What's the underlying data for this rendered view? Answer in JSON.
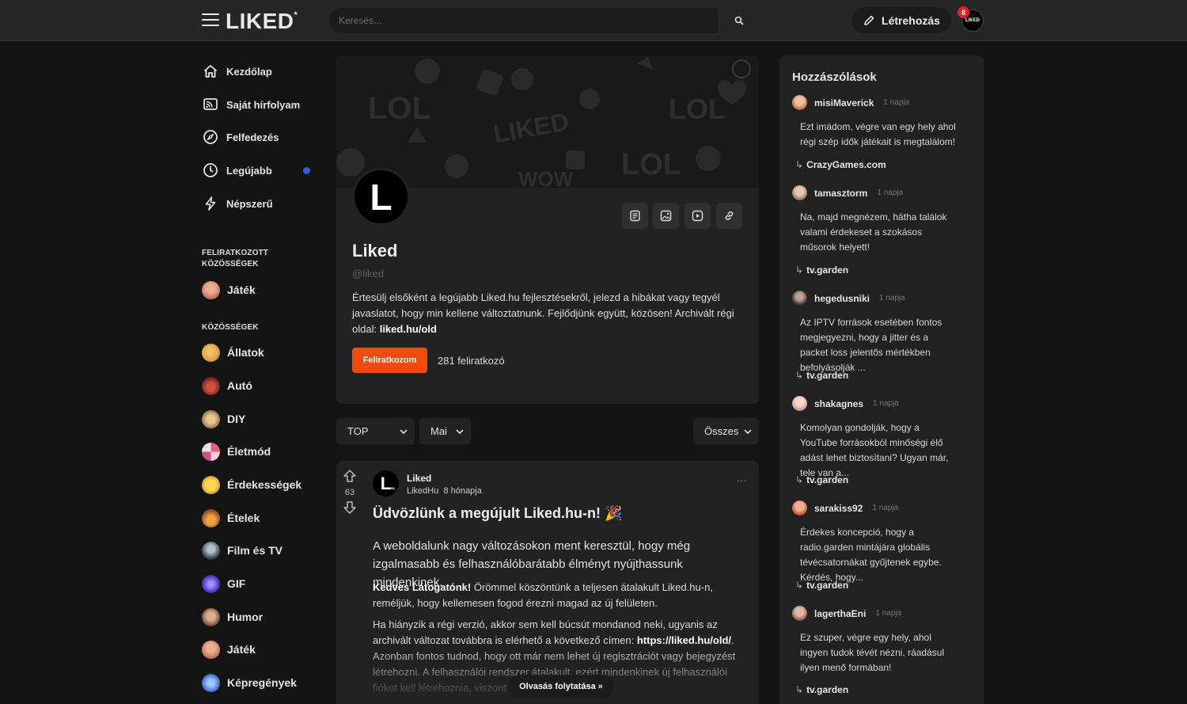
{
  "header": {
    "logo": "LIKED",
    "logo_mark": "*",
    "search_placeholder": "Keresés...",
    "create_label": "Létrehozás",
    "notification_count": "8",
    "avatar_label": "LIKED"
  },
  "nav": [
    {
      "label": "Kezdőlap",
      "icon": "home-icon"
    },
    {
      "label": "Saját hírfolyam",
      "icon": "feed-icon"
    },
    {
      "label": "Felfedezés",
      "icon": "compass-icon"
    },
    {
      "label": "Legújabb",
      "icon": "clock-icon"
    },
    {
      "label": "Népszerű",
      "icon": "bolt-icon"
    }
  ],
  "subscribed": {
    "title_line1": "FELIRATKOZOTT",
    "title_line2": "KÖZÖSSÉGEK",
    "items": [
      {
        "label": "Játék"
      }
    ]
  },
  "communities": {
    "title": "KÖZÖSSÉGEK",
    "items": [
      {
        "label": "Állatok",
        "color": "#e0a040"
      },
      {
        "label": "Autó",
        "color": "#b03a30"
      },
      {
        "label": "DIY",
        "color": "#c8a060"
      },
      {
        "label": "Életmód",
        "color": "#d05080"
      },
      {
        "label": "Érdekességek",
        "color": "#e8b830"
      },
      {
        "label": "Ételek",
        "color": "#d08030"
      },
      {
        "label": "Film és TV",
        "color": "#708090"
      },
      {
        "label": "GIF",
        "color": "#5040d0"
      },
      {
        "label": "Humor",
        "color": "#a08060"
      },
      {
        "label": "Játék",
        "color": "#c87060"
      },
      {
        "label": "Képregények",
        "color": "#4a78d0"
      }
    ]
  },
  "profile": {
    "avatar_letter": "L",
    "name": "Liked",
    "handle": "@liked",
    "description": "Értesülj elsőként a legújabb Liked.hu fejlesztésekről, jelezd a hibákat vagy tegyél javaslatot, hogy min kellene változtatnunk. Fejlődjünk együtt, közösen! Archivált régi oldal: ",
    "old_link": "liked.hu/old",
    "subscribe_label": "Feliratkozom",
    "subscriber_count": "281 feliratkozó"
  },
  "filters": {
    "sort": "TOP",
    "period": "Mai",
    "scope": "Összes"
  },
  "post": {
    "votes": "63",
    "author": "Liked",
    "community": "LikedHu",
    "time": "8 hónapja",
    "avatar_sub": "LIKED",
    "title": "Üdvözlünk a megújult Liked.hu-n! 🎉",
    "lead": "A weboldalunk nagy változásokon ment keresztül, hogy még izgalmasabb és felhasználóbarátabb élményt nyújthassunk mindenkinek.",
    "p1_bold": "Kedves Látogatónk!",
    "p1": " Örömmel köszöntünk a teljesen átalakult Liked.hu-n, reméljük, hogy kellemesen fogod érezni magad az új felületen.",
    "p2_a": "Ha hiányzik a régi verzió, akkor sem kell búcsút mondanod neki, ugyanis az archivált változat továbbra is elérhető a következő címen: ",
    "p2_link": "https://liked.hu/old/",
    "p2_b": ". Azonban fontos tudnod, hogy ott már nem lehet új regisztrációt vagy bejegyzést létrehozni. A felhasználói rendszer átalakult, ezért mindenkinek új felhasználói fiókot kell létrehoznia, viszont",
    "read_more": "Olvasás folytatása »"
  },
  "comments_panel": {
    "title": "Hozzászólások",
    "items": [
      {
        "user": "misiMaverick",
        "time": "1 napja",
        "text": "Ezt imádom, végre van egy hely ahol régi szép idők játékait is megtalálom!",
        "link": "CrazyGames.com",
        "color": "#d08a5a"
      },
      {
        "user": "tamasztorm",
        "time": "1 napja",
        "text": "Na, majd megnézem, hátha találok valami érdekeset a szokásos műsorok helyett!",
        "link": "tv.garden",
        "color": "#b09070"
      },
      {
        "user": "hegedusniki",
        "time": "1 napja",
        "text": "Az IPTV források esetében fontos megjegyezni, hogy a jitter és a packet loss jelentős mértékben befolyásolják ...",
        "link": "tv.garden",
        "color": "#555555"
      },
      {
        "user": "shakagnes",
        "time": "1 napja",
        "text": "Komolyan gondolják, hogy a YouTube forrásokból minőségi élő adást lehet biztosítani? Ugyan már, tele van a...",
        "link": "tv.garden",
        "color": "#e8c0b0"
      },
      {
        "user": "sarakiss92",
        "time": "1 napja",
        "text": "Érdekes koncepció, hogy a radio.garden mintájára globális tévécsatornákat gyűjtenek egybe. Kérdés, hogy...",
        "link": "tv.garden",
        "color": "#d06040"
      },
      {
        "user": "lagerthaEni",
        "time": "1 napja",
        "text": "Ez szuper, végre egy hely, ahol ingyen tudok tévét nézni, ráadásul ilyen menő formában!",
        "link": "tv.garden",
        "color": "#a07060"
      }
    ]
  }
}
